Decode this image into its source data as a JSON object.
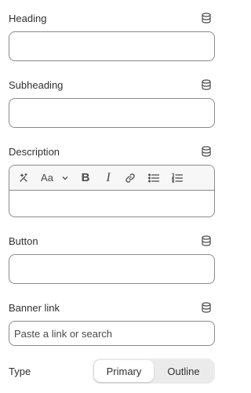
{
  "fields": {
    "heading": {
      "label": "Heading",
      "value": "",
      "icon": "database-icon"
    },
    "subheading": {
      "label": "Subheading",
      "value": "",
      "icon": "database-icon"
    },
    "description": {
      "label": "Description",
      "value": "",
      "icon": "database-icon",
      "toolbar": {
        "font_label": "Aa",
        "bold_label": "B",
        "italic_label": "I",
        "icons": [
          "magic-icon",
          "font-style-icon",
          "chevron-down-icon",
          "bold-icon",
          "italic-icon",
          "link-icon",
          "bullet-list-icon",
          "numbered-list-icon"
        ]
      }
    },
    "button": {
      "label": "Button",
      "value": "",
      "icon": "database-icon"
    },
    "banner_link": {
      "label": "Banner link",
      "value": "",
      "placeholder": "Paste a link or search",
      "icon": "database-icon"
    }
  },
  "type": {
    "label": "Type",
    "options": [
      "Primary",
      "Outline"
    ],
    "selected": "Primary"
  },
  "colors": {
    "border": "#8a8a8a",
    "text": "#303030",
    "segment_bg": "#ebebeb",
    "toolbar_bg": "#f7f7f7"
  }
}
